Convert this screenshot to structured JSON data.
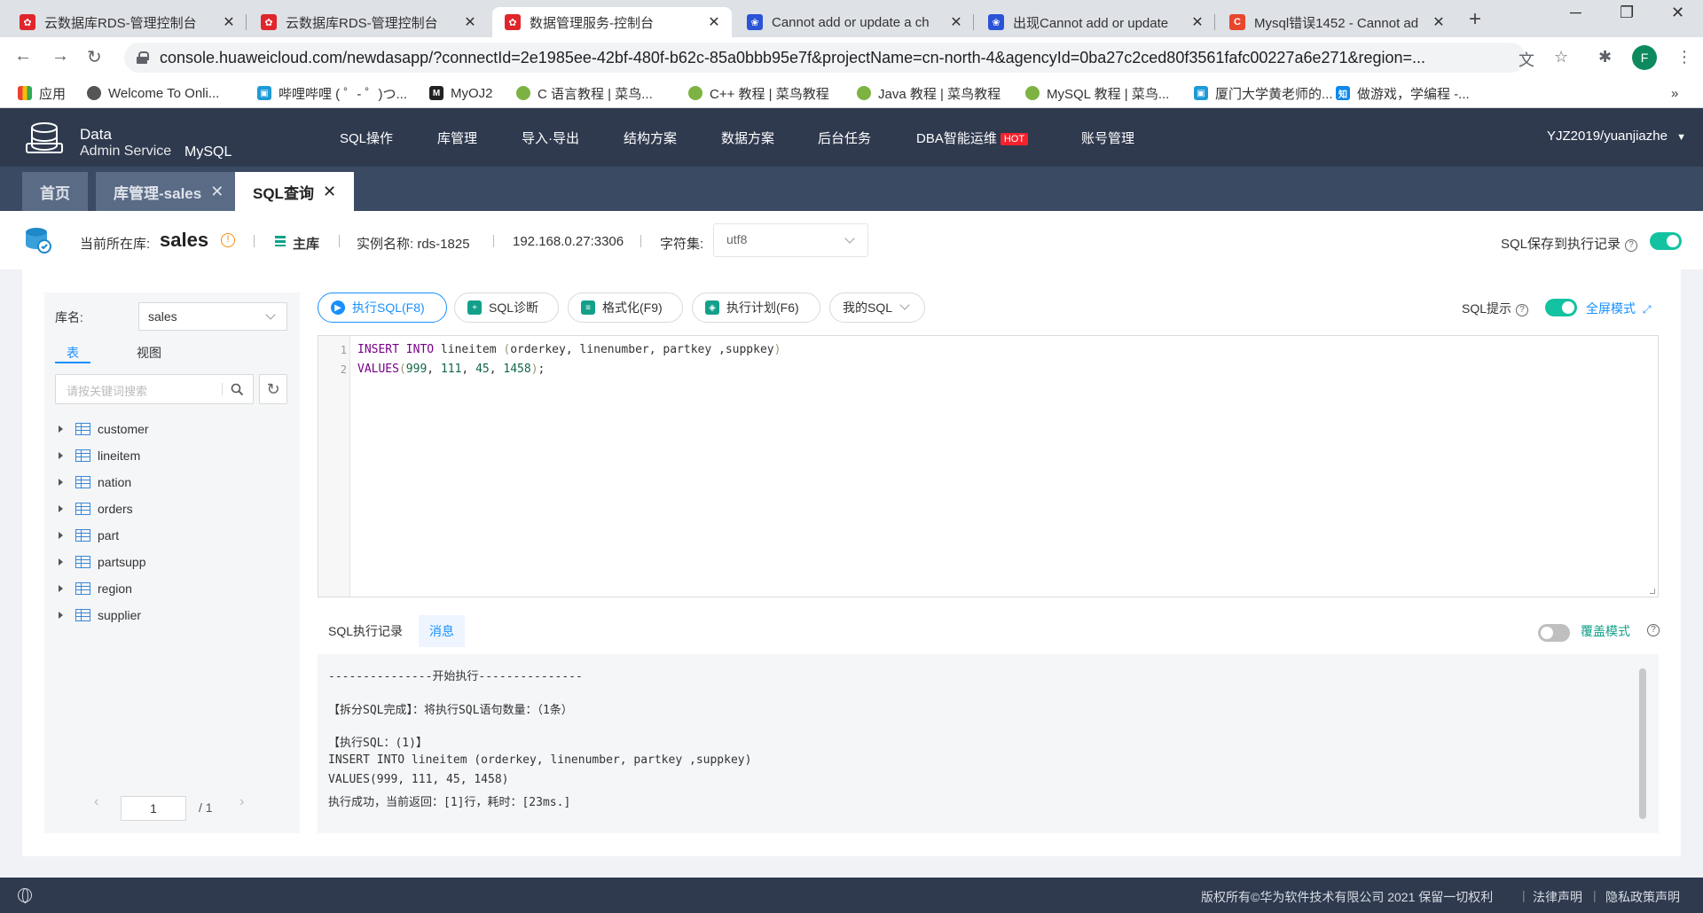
{
  "browser": {
    "tabs": [
      {
        "title": "云数据库RDS-管理控制台",
        "icon": "huawei-icon",
        "active": false
      },
      {
        "title": "云数据库RDS-管理控制台",
        "icon": "huawei-icon",
        "active": false
      },
      {
        "title": "数据管理服务-控制台",
        "icon": "huawei-icon",
        "active": true
      },
      {
        "title": "Cannot add or update a ch",
        "icon": "baidu-paw-icon",
        "active": false
      },
      {
        "title": "出现Cannot add or update",
        "icon": "baidu-paw-icon",
        "active": false
      },
      {
        "title": "Mysql错误1452 - Cannot ad",
        "icon": "csdn-icon",
        "active": false
      }
    ],
    "url": "console.huaweicloud.com/newdasapp/?connectId=2e1985ee-42bf-480f-b62c-85a0bbb95e7f&projectName=cn-north-4&agencyId=0ba27c2ced80f3561fafc00227a6e271&region=...",
    "profile_initial": "F",
    "bookmarks": [
      {
        "label": "应用",
        "icon": "apps-grid-icon"
      },
      {
        "label": "Welcome To Onli...",
        "icon": "globe-icon"
      },
      {
        "label": "哔哩哔哩 ( ゜- ゜)つ...",
        "icon": "bilibili-icon"
      },
      {
        "label": "MyOJ2",
        "icon": "myoj-icon"
      },
      {
        "label": "C 语言教程 | 菜鸟...",
        "icon": "runoob-icon"
      },
      {
        "label": "C++ 教程 | 菜鸟教程",
        "icon": "runoob-icon"
      },
      {
        "label": "Java 教程 | 菜鸟教程",
        "icon": "runoob-icon"
      },
      {
        "label": "MySQL 教程 | 菜鸟...",
        "icon": "runoob-icon"
      },
      {
        "label": "厦门大学黄老师的...",
        "icon": "bilibili-icon"
      },
      {
        "label": "做游戏，学编程 -...",
        "icon": "zhihu-icon"
      }
    ],
    "bookmarks_more": "»"
  },
  "app": {
    "brand_line1": "Data",
    "brand_line2": "Admin Service",
    "brand_engine": "MySQL",
    "menu": [
      "SQL操作",
      "库管理",
      "导入·导出",
      "结构方案",
      "数据方案",
      "后台任务",
      "DBA智能运维",
      "账号管理"
    ],
    "hot_badge": "HOT",
    "user": "YJZ2019/yuanjiazhe"
  },
  "app_tabs": [
    {
      "label": "首页",
      "closable": false
    },
    {
      "label": "库管理-sales",
      "closable": true
    },
    {
      "label": "SQL查询",
      "closable": true
    }
  ],
  "infobar": {
    "current_db_label": "当前所在库:",
    "current_db": "sales",
    "role": "主库",
    "instance": "实例名称:  rds-1825",
    "address": "192.168.0.27:3306",
    "charset_label": "字符集:",
    "charset": "utf8",
    "save_history_label": "SQL保存到执行记录",
    "save_history_on": true
  },
  "sidebar": {
    "db_label": "库名:",
    "db_value": "sales",
    "tabs": [
      "表",
      "视图"
    ],
    "search_placeholder": "请按关键词搜索",
    "tables": [
      "customer",
      "lineitem",
      "nation",
      "orders",
      "part",
      "partsupp",
      "region",
      "supplier"
    ],
    "page_current": "1",
    "page_total": "/ 1"
  },
  "toolbar": {
    "execute": "执行SQL(F8)",
    "diagnose": "SQL诊断",
    "format": "格式化(F9)",
    "plan": "执行计划(F6)",
    "my_sql": "我的SQL",
    "sql_hint": "SQL提示",
    "sql_hint_on": true,
    "fullscreen": "全屏模式"
  },
  "editor": {
    "lines": [
      {
        "n": "1"
      },
      {
        "n": "2"
      }
    ],
    "line1": {
      "kw": "INSERT INTO",
      "table": " lineitem ",
      "lp": "(",
      "cols": "orderkey, linenumber, partkey ,suppkey",
      "rp": ")"
    },
    "line2": {
      "kw": "VALUES",
      "lp": "(",
      "v1": "999",
      "c1": ", ",
      "v2": "111",
      "c2": ", ",
      "v3": "45",
      "c3": ", ",
      "v4": "1458",
      "rp": ")",
      "end": ";"
    }
  },
  "results": {
    "tabs": [
      "SQL执行记录",
      "消息"
    ],
    "cover_mode_label": "覆盖模式",
    "cover_mode_on": false,
    "messages": [
      "---------------开始执行---------------",
      "【拆分SQL完成】：将执行SQL语句数量：（1条）",
      "【执行SQL：(1)】",
      "INSERT INTO lineitem (orderkey, linenumber, partkey ,suppkey)",
      "VALUES(999, 111, 45, 1458)",
      "执行成功，当前返回：[1]行，耗时：[23ms.]"
    ]
  },
  "footer": {
    "copyright": "版权所有©华为软件技术有限公司 2021 保留一切权利",
    "legal": "法律声明",
    "privacy": "隐私政策声明"
  }
}
